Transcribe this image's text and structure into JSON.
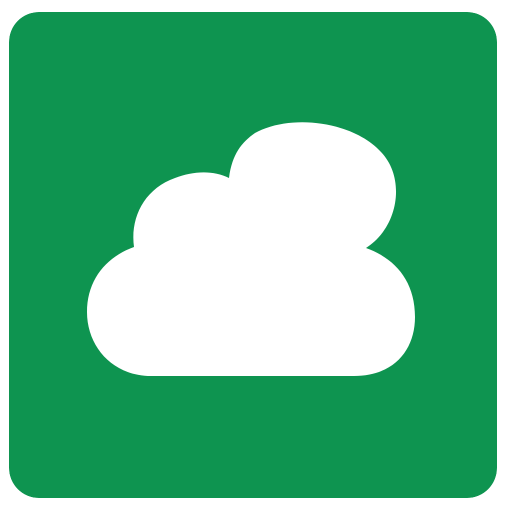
{
  "icon": {
    "name": "cloud-icon",
    "background_color": "#0E9450",
    "glyph_color": "#FFFFFF"
  }
}
